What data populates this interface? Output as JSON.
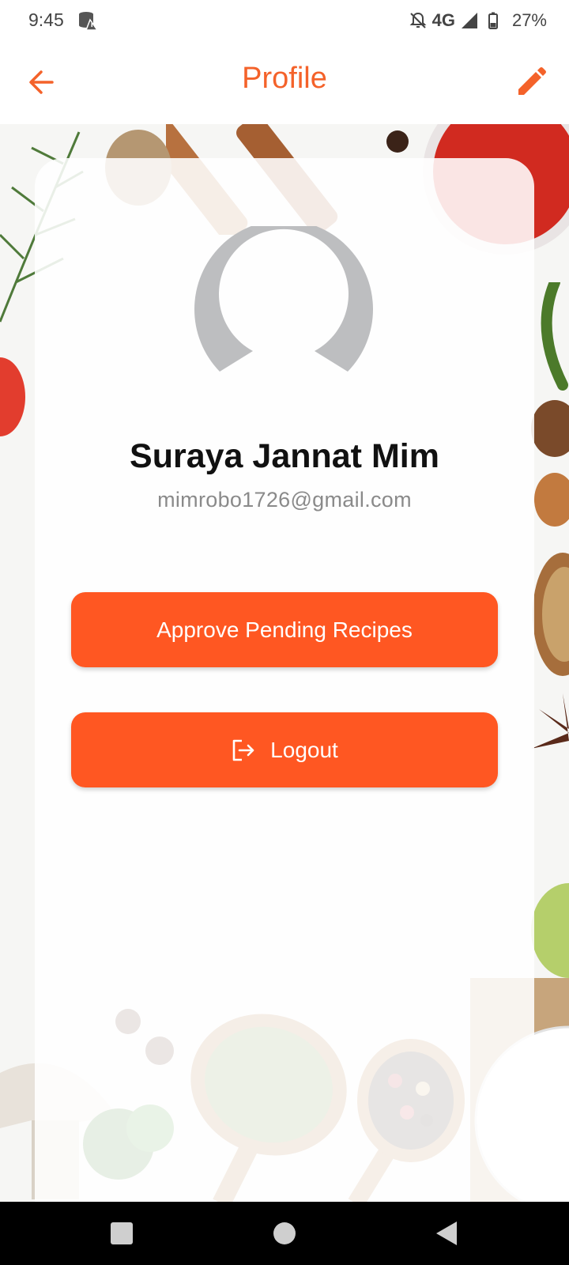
{
  "status_bar": {
    "time": "9:45",
    "network": "4G",
    "battery": "27%",
    "icons": [
      "storage-warning-icon",
      "mute-icon",
      "signal-icon",
      "battery-icon"
    ]
  },
  "app_bar": {
    "title": "Profile",
    "back_icon": "arrow-left-icon",
    "edit_icon": "pencil-icon"
  },
  "profile": {
    "name": "Suraya Jannat Mim",
    "email": "mimrobo1726@gmail.com",
    "avatar_icon": "default-user-avatar-icon"
  },
  "actions": {
    "approve_label": "Approve Pending Recipes",
    "logout_label": "Logout",
    "logout_icon": "logout-icon"
  },
  "nav_bar": {
    "icons": [
      "recent-apps-icon",
      "home-icon",
      "back-triangle-icon"
    ]
  },
  "colors": {
    "accent": "#FF5722",
    "title": "#F4622A",
    "avatar": "#BDBEC0",
    "email": "#8a8a8a"
  }
}
